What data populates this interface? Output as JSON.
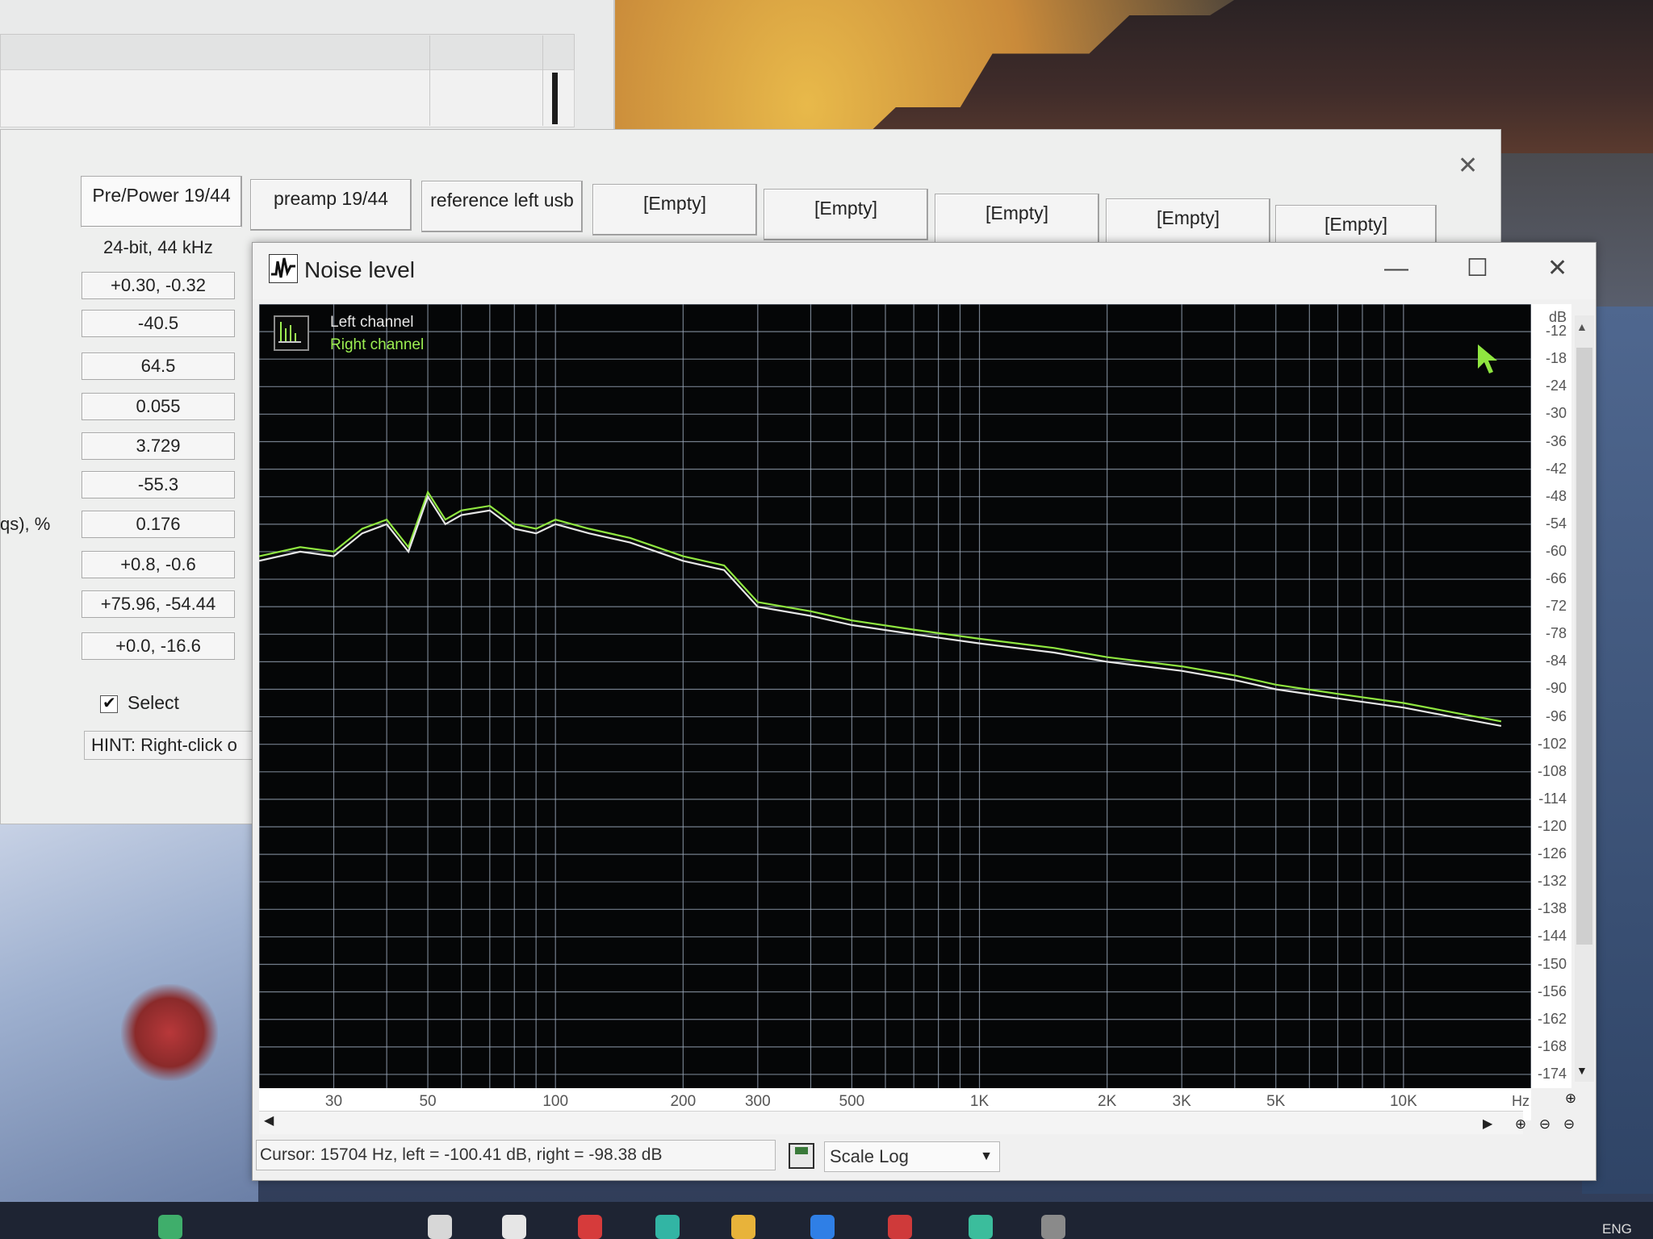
{
  "main_window": {
    "tabs": [
      {
        "label": "Pre/Power 19/44",
        "active": true
      },
      {
        "label": "preamp 19/44",
        "active": false
      },
      {
        "label": "reference left usb",
        "active": false
      },
      {
        "label": "[Empty]",
        "active": false
      },
      {
        "label": "[Empty]",
        "active": false
      },
      {
        "label": "[Empty]",
        "active": false
      },
      {
        "label": "[Empty]",
        "active": false
      },
      {
        "label": "[Empty]",
        "active": false
      }
    ],
    "format_label": "24-bit, 44 kHz",
    "values": [
      "+0.30, -0.32",
      "-40.5",
      "64.5",
      "0.055",
      "3.729",
      "-55.3",
      "0.176",
      "+0.8, -0.6",
      "+75.96, -54.44",
      "+0.0, -16.6"
    ],
    "partial_label": "qs), %",
    "select_label": "Select",
    "select_checked": true,
    "hint": "HINT: Right-click o"
  },
  "noise_window": {
    "title": "Noise level",
    "legend": {
      "left": "Left channel",
      "right": "Right channel"
    },
    "db_unit": "dB",
    "hz_unit": "Hz",
    "status": "Cursor:  15704 Hz,  left = -100.41 dB,  right = -98.38 dB",
    "scale_label": "Scale",
    "scale_value": "Log"
  },
  "colors": {
    "left_channel": "#e6e6e6",
    "right_channel": "#8fe640",
    "grid": "#9aa6b8",
    "plot_bg": "#050607"
  },
  "chart_data": {
    "type": "line",
    "title": "",
    "xscale": "log",
    "xlabel": "Hz",
    "ylabel": "dB",
    "xlim": [
      20,
      20000
    ],
    "ylim": [
      -177,
      -6
    ],
    "x_ticks": [
      "30",
      "50",
      "100",
      "200",
      "300",
      "500",
      "1K",
      "2K",
      "3K",
      "5K",
      "10K"
    ],
    "x_tick_values": [
      30,
      50,
      100,
      200,
      300,
      500,
      1000,
      2000,
      3000,
      5000,
      10000
    ],
    "y_ticks": [
      -12,
      -18,
      -24,
      -30,
      -36,
      -42,
      -48,
      -54,
      -60,
      -66,
      -72,
      -78,
      -84,
      -90,
      -96,
      -102,
      -108,
      -114,
      -120,
      -126,
      -132,
      -138,
      -144,
      -150,
      -156,
      -162,
      -168,
      -174
    ],
    "series": [
      {
        "name": "Left channel",
        "color": "#e6e6e6",
        "x": [
          20,
          25,
          30,
          35,
          40,
          45,
          50,
          55,
          60,
          70,
          80,
          90,
          100,
          120,
          150,
          200,
          250,
          300,
          400,
          500,
          700,
          1000,
          1500,
          2000,
          3000,
          4000,
          5000,
          7000,
          10000,
          13000,
          17000
        ],
        "y": [
          -62,
          -60,
          -61,
          -56,
          -54,
          -60,
          -48,
          -54,
          -52,
          -51,
          -55,
          -56,
          -54,
          -56,
          -58,
          -62,
          -64,
          -72,
          -74,
          -76,
          -78,
          -80,
          -82,
          -84,
          -86,
          -88,
          -90,
          -92,
          -94,
          -96,
          -98
        ]
      },
      {
        "name": "Right channel",
        "color": "#8fe640",
        "x": [
          20,
          25,
          30,
          35,
          40,
          45,
          50,
          55,
          60,
          70,
          80,
          90,
          100,
          120,
          150,
          200,
          250,
          300,
          400,
          500,
          700,
          1000,
          1500,
          2000,
          3000,
          4000,
          5000,
          7000,
          10000,
          13000,
          17000
        ],
        "y": [
          -61,
          -59,
          -60,
          -55,
          -53,
          -59,
          -47,
          -53,
          -51,
          -50,
          -54,
          -55,
          -53,
          -55,
          -57,
          -61,
          -63,
          -71,
          -73,
          -75,
          -77,
          -79,
          -81,
          -83,
          -85,
          -87,
          -89,
          -91,
          -93,
          -95,
          -97
        ]
      }
    ],
    "grid": true,
    "legend_position": "top-left"
  }
}
